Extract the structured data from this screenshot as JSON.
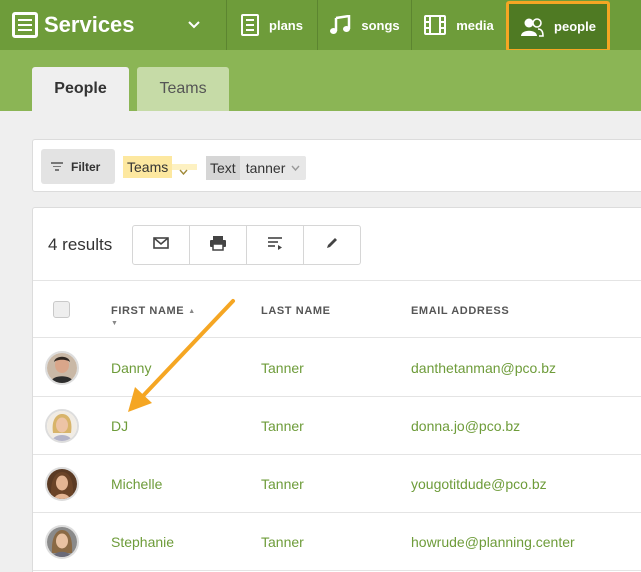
{
  "app": {
    "name": "Services",
    "nav": [
      {
        "key": "plans",
        "label": "plans",
        "icon": "document-icon"
      },
      {
        "key": "songs",
        "label": "songs",
        "icon": "music-note-icon"
      },
      {
        "key": "media",
        "label": "media",
        "icon": "film-icon"
      },
      {
        "key": "people",
        "label": "people",
        "icon": "people-icon",
        "active": true
      }
    ]
  },
  "tabs": [
    {
      "label": "People",
      "active": true
    },
    {
      "label": "Teams",
      "active": false
    }
  ],
  "filters": {
    "filter_label": "Filter",
    "teams_label": "Teams",
    "text_key": "Text",
    "text_value": "tanner"
  },
  "results": {
    "count_label": "4 results",
    "toolbar": [
      "mail-icon",
      "print-icon",
      "sort-list-icon",
      "pencil-icon"
    ],
    "columns": [
      "FIRST NAME",
      "LAST NAME",
      "EMAIL ADDRESS"
    ],
    "rows": [
      {
        "first": "Danny",
        "last": "Tanner",
        "email": "danthetanman@pco.bz"
      },
      {
        "first": "DJ",
        "last": "Tanner",
        "email": "donna.jo@pco.bz"
      },
      {
        "first": "Michelle",
        "last": "Tanner",
        "email": "yougotitdude@pco.bz"
      },
      {
        "first": "Stephanie",
        "last": "Tanner",
        "email": "howrude@planning.center"
      }
    ]
  },
  "colors": {
    "brand_green": "#6e9c3a",
    "light_green": "#8bb555",
    "highlight_orange": "#f5a623",
    "link_green": "#6e9c3a"
  },
  "annotation": {
    "icon": "orange-arrow-annotation"
  }
}
